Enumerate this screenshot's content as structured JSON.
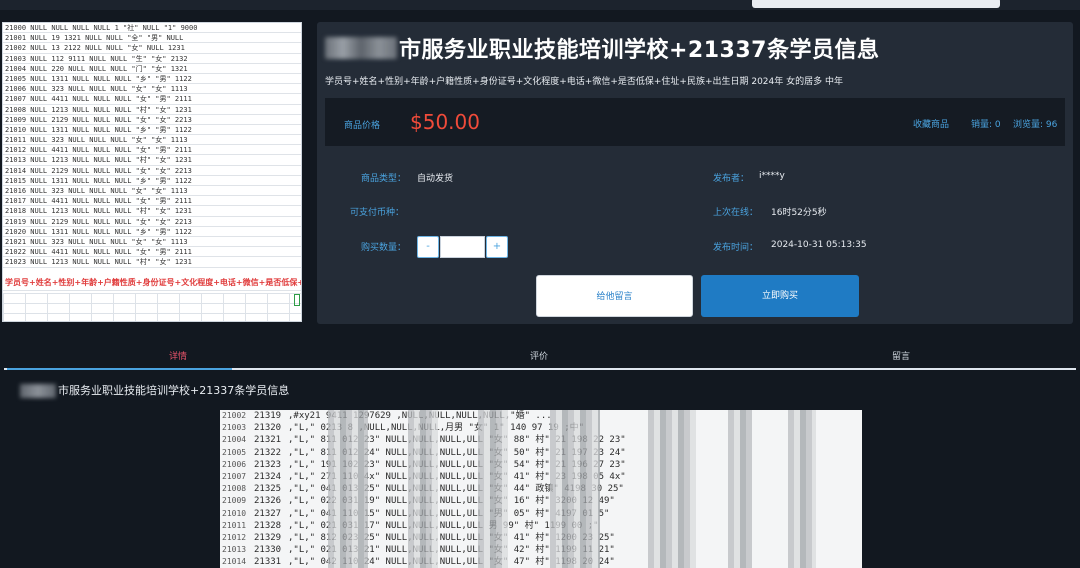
{
  "header": {
    "search_placeholder": ""
  },
  "thumbnail": {
    "rows": [
      "21000 NULL NULL NULL NULL 1 \"社\" NULL \"1\" 9000",
      "21001 NULL 19 1321 NULL NULL \"全\" \"男\" NULL",
      "21002 NULL 13 2122 NULL NULL \"女\" NULL 1231",
      "21003 NULL 112 9111 NULL NULL \"生\" \"女\" 2132",
      "21004 NULL 220 NULL NULL NULL \"门\" \"女\" 1321",
      "21005 NULL 1311 NULL NULL NULL \"乡\" \"男\" 1122",
      "21006 NULL 323 NULL NULL NULL \"女\" \"女\" 1113",
      "21007 NULL 4411 NULL NULL NULL \"女\" \"男\" 2111",
      "21008 NULL 1213 NULL NULL NULL \"村\" \"女\" 1231",
      "21009 NULL 2129 NULL NULL NULL \"女\" \"女\" 2213",
      "21010 NULL 1311 NULL NULL NULL \"乡\" \"男\" 1122",
      "21011 NULL 323 NULL NULL NULL \"女\" \"女\" 1113",
      "21012 NULL 4411 NULL NULL NULL \"女\" \"男\" 2111",
      "21013 NULL 1213 NULL NULL NULL \"村\" \"女\" 1231",
      "21014 NULL 2129 NULL NULL NULL \"女\" \"女\" 2213",
      "21015 NULL 1311 NULL NULL NULL \"乡\" \"男\" 1122",
      "21016 NULL 323 NULL NULL NULL \"女\" \"女\" 1113",
      "21017 NULL 4411 NULL NULL NULL \"女\" \"男\" 2111",
      "21018 NULL 1213 NULL NULL NULL \"村\" \"女\" 1231",
      "21019 NULL 2129 NULL NULL NULL \"女\" \"女\" 2213",
      "21020 NULL 1311 NULL NULL NULL \"乡\" \"男\" 1122",
      "21021 NULL 323 NULL NULL NULL \"女\" \"女\" 1113",
      "21022 NULL 4411 NULL NULL NULL \"女\" \"男\" 2111",
      "21023 NULL 1213 NULL NULL NULL \"村\" \"女\" 1231"
    ],
    "header_row": "学员号+姓名+性别+年龄+户籍性质+身份证号+文化程度+电话+微信+是否低保+住址+民族+出生年"
  },
  "product": {
    "title": "市服务业职业技能培训学校+21337条学员信息",
    "subtitle": "学员号+姓名+性别+年龄+户籍性质+身份证号+文化程度+电话+微信+是否低保+住址+民族+出生日期 2024年 女的居多 中年",
    "price_label": "商品价格",
    "price": "$50.00",
    "favorite_label": "收藏商品",
    "sales": "销量: 0",
    "views": "浏览量: 96",
    "type_label": "商品类型：",
    "type_value": "自动发货",
    "currency_label": "可支付币种：",
    "qty_label": "购买数量：",
    "qty_minus": "-",
    "qty_plus": "+",
    "qty_value": "",
    "publisher_label": "发布者：",
    "publisher_value": "i****y",
    "last_online_label": "上次在线：",
    "last_online_value": "16时52分5秒",
    "publish_time_label": "发布时间：",
    "publish_time_value": "2024-10-31 05:13:35",
    "message_button": "给他留言",
    "buy_button": "立即购买"
  },
  "tabs": [
    {
      "label": "详情"
    },
    {
      "label": "评价"
    },
    {
      "label": "留言"
    }
  ],
  "detail": {
    "title": "市服务业职业技能培训学校+21337条学员信息",
    "rows": [
      {
        "rn": "21002",
        "c1": "21319",
        "c2": ",#xy21 9411 1297629 ,NULL,NULL,NULL,NULL,\"婚\" ..."
      },
      {
        "rn": "21003",
        "c1": "21320",
        "c2": ",\"L,\" 0213 8  ,NULL,NULL,NULL,月男 \"女\"  1\" 140  97  19  ;中\""
      },
      {
        "rn": "21004",
        "c1": "21321",
        "c2": ",\"L,\" 811 012 23\" NULL,NULL,NULL,ULL \"女\" 88\" 村\" 21  198  22 23\""
      },
      {
        "rn": "21005",
        "c1": "21322",
        "c2": ",\"L,\" 811 012 24\" NULL,NULL,NULL,ULL \"女\" 50\" 村\" 21  197  23 24\""
      },
      {
        "rn": "21006",
        "c1": "21323",
        "c2": ",\"L,\" 191 102 23\" NULL,NULL,NULL,ULL \"女\" 54\" 村\" 21  196  27 23\""
      },
      {
        "rn": "21007",
        "c1": "21324",
        "c2": ",\"L,\" 271 110 4x\" NULL,NULL,NULL,ULL \"女\" 41\" 村\" 23  198  05 4x\""
      },
      {
        "rn": "21008",
        "c1": "21325",
        "c2": ",\"L,\" 041 013 25\" NULL,NULL,NULL,ULL \"女\" 44\" 政镇\" 4198  30 25\""
      },
      {
        "rn": "21009",
        "c1": "21326",
        "c2": ",\"L,\" 022 031 19\" NULL,NULL,NULL,ULL \"女\" 16\" 村\" 3200  12 49\""
      },
      {
        "rn": "21010",
        "c1": "21327",
        "c2": ",\"L,\" 041 110 15\" NULL,NULL,NULL,ULL \"男\" 05\" 村\" 4197  01  5\""
      },
      {
        "rn": "21011",
        "c1": "21328",
        "c2": ",\"L,\" 021 031 17\" NULL,NULL,NULL,ULL 男 99\" 村\" 1199  00 ;\""
      },
      {
        "rn": "21012",
        "c1": "21329",
        "c2": ",\"L,\" 812 023 25\" NULL,NULL,NULL,ULL \"女\" 41\" 村\" 1200  23 25\""
      },
      {
        "rn": "21013",
        "c1": "21330",
        "c2": ",\"L,\" 021 013 21\" NULL,NULL,NULL,ULL \"女\" 42\" 村\" 1199  11 21\""
      },
      {
        "rn": "21014",
        "c1": "21331",
        "c2": ",\"L,\" 042 110 24\" NULL,NULL,NULL,ULL \"女\" 47\" 村\" 1198  20 24\""
      }
    ]
  },
  "colors": {
    "background": "#121820",
    "panel": "#242c37",
    "accent_blue": "#4aa3df",
    "price_red": "#f04b3a",
    "active_tab": "#e8536a",
    "buy_button": "#1f7bc4"
  }
}
